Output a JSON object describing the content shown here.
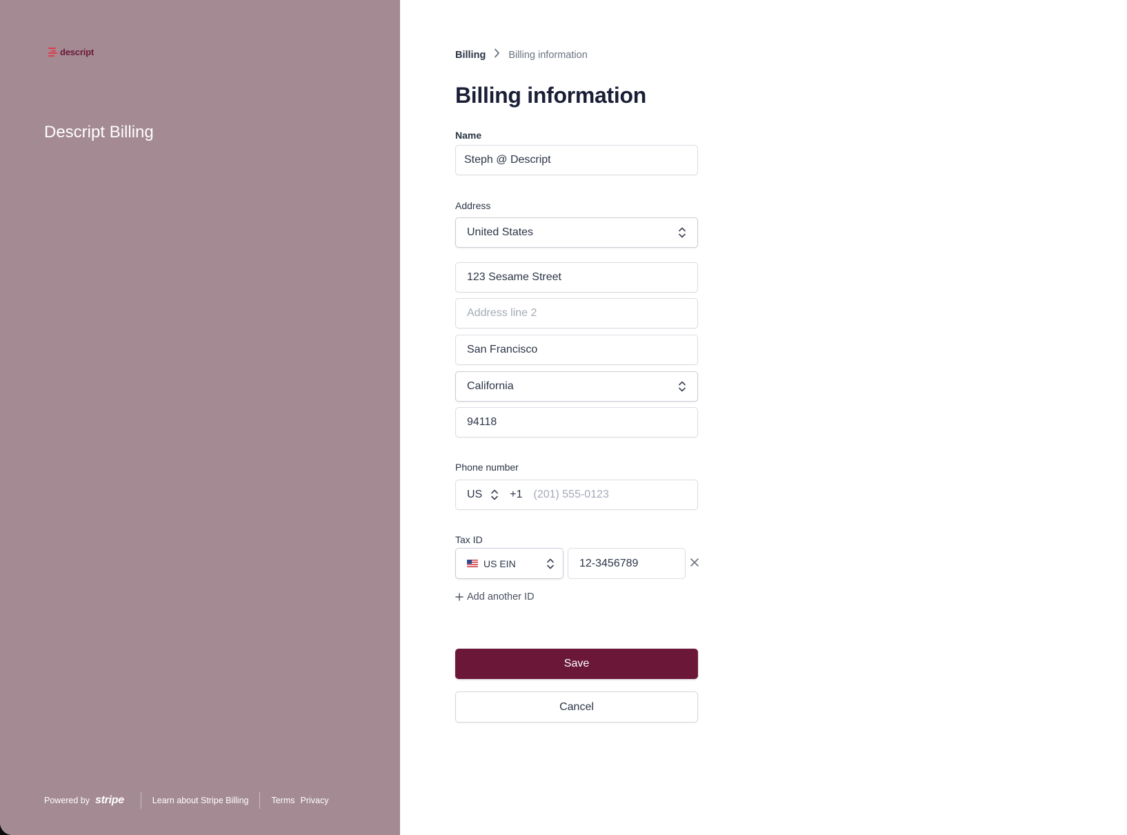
{
  "brand": {
    "logo_text": "descript",
    "title": "Descript Billing"
  },
  "footer": {
    "powered_by": "Powered by",
    "stripe": "stripe",
    "learn": "Learn about Stripe Billing",
    "terms": "Terms",
    "privacy": "Privacy"
  },
  "breadcrumb": {
    "root": "Billing",
    "current": "Billing information"
  },
  "page": {
    "title": "Billing information"
  },
  "form": {
    "name_label": "Name",
    "name_value": "Steph @ Descript",
    "address_label": "Address",
    "country": "United States",
    "line1": "123 Sesame Street",
    "line2_placeholder": "Address line 2",
    "city": "San Francisco",
    "state": "California",
    "zip": "94118",
    "phone_label": "Phone number",
    "phone_country": "US",
    "phone_code": "+1",
    "phone_placeholder": "(201) 555-0123",
    "tax_label": "Tax ID",
    "tax_type": "US EIN",
    "tax_value": "12-3456789",
    "add_id": "Add another ID",
    "save": "Save",
    "cancel": "Cancel"
  },
  "colors": {
    "left_panel": "#a48a92",
    "accent": "#6b1838",
    "logo_mark": "#e23a4c"
  },
  "icons": [
    "chevron-right-icon",
    "select-chevrons-icon",
    "us-flag-icon",
    "close-icon",
    "plus-icon"
  ]
}
